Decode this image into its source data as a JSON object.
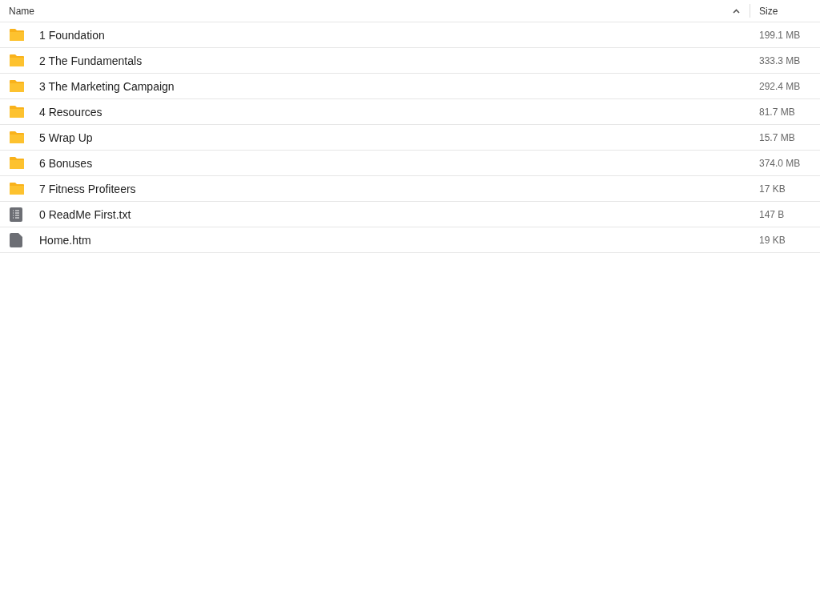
{
  "columns": [
    {
      "label": "Name",
      "sorted": true
    },
    {
      "label": "Size",
      "sorted": false
    }
  ],
  "rows": [
    {
      "kind": "folder",
      "name": "1 Foundation",
      "size": "199.1 MB"
    },
    {
      "kind": "folder",
      "name": "2 The Fundamentals",
      "size": "333.3 MB"
    },
    {
      "kind": "folder",
      "name": "3 The Marketing Campaign",
      "size": "292.4 MB"
    },
    {
      "kind": "folder",
      "name": "4 Resources",
      "size": "81.7 MB"
    },
    {
      "kind": "folder",
      "name": "5 Wrap Up",
      "size": "15.7 MB"
    },
    {
      "kind": "folder",
      "name": "6 Bonuses",
      "size": "374.0 MB"
    },
    {
      "kind": "folder",
      "name": "7 Fitness Profiteers",
      "size": "17 KB"
    },
    {
      "kind": "text",
      "name": "0 ReadMe First.txt",
      "size": "147 B"
    },
    {
      "kind": "file",
      "name": "Home.htm",
      "size": "19 KB"
    }
  ]
}
